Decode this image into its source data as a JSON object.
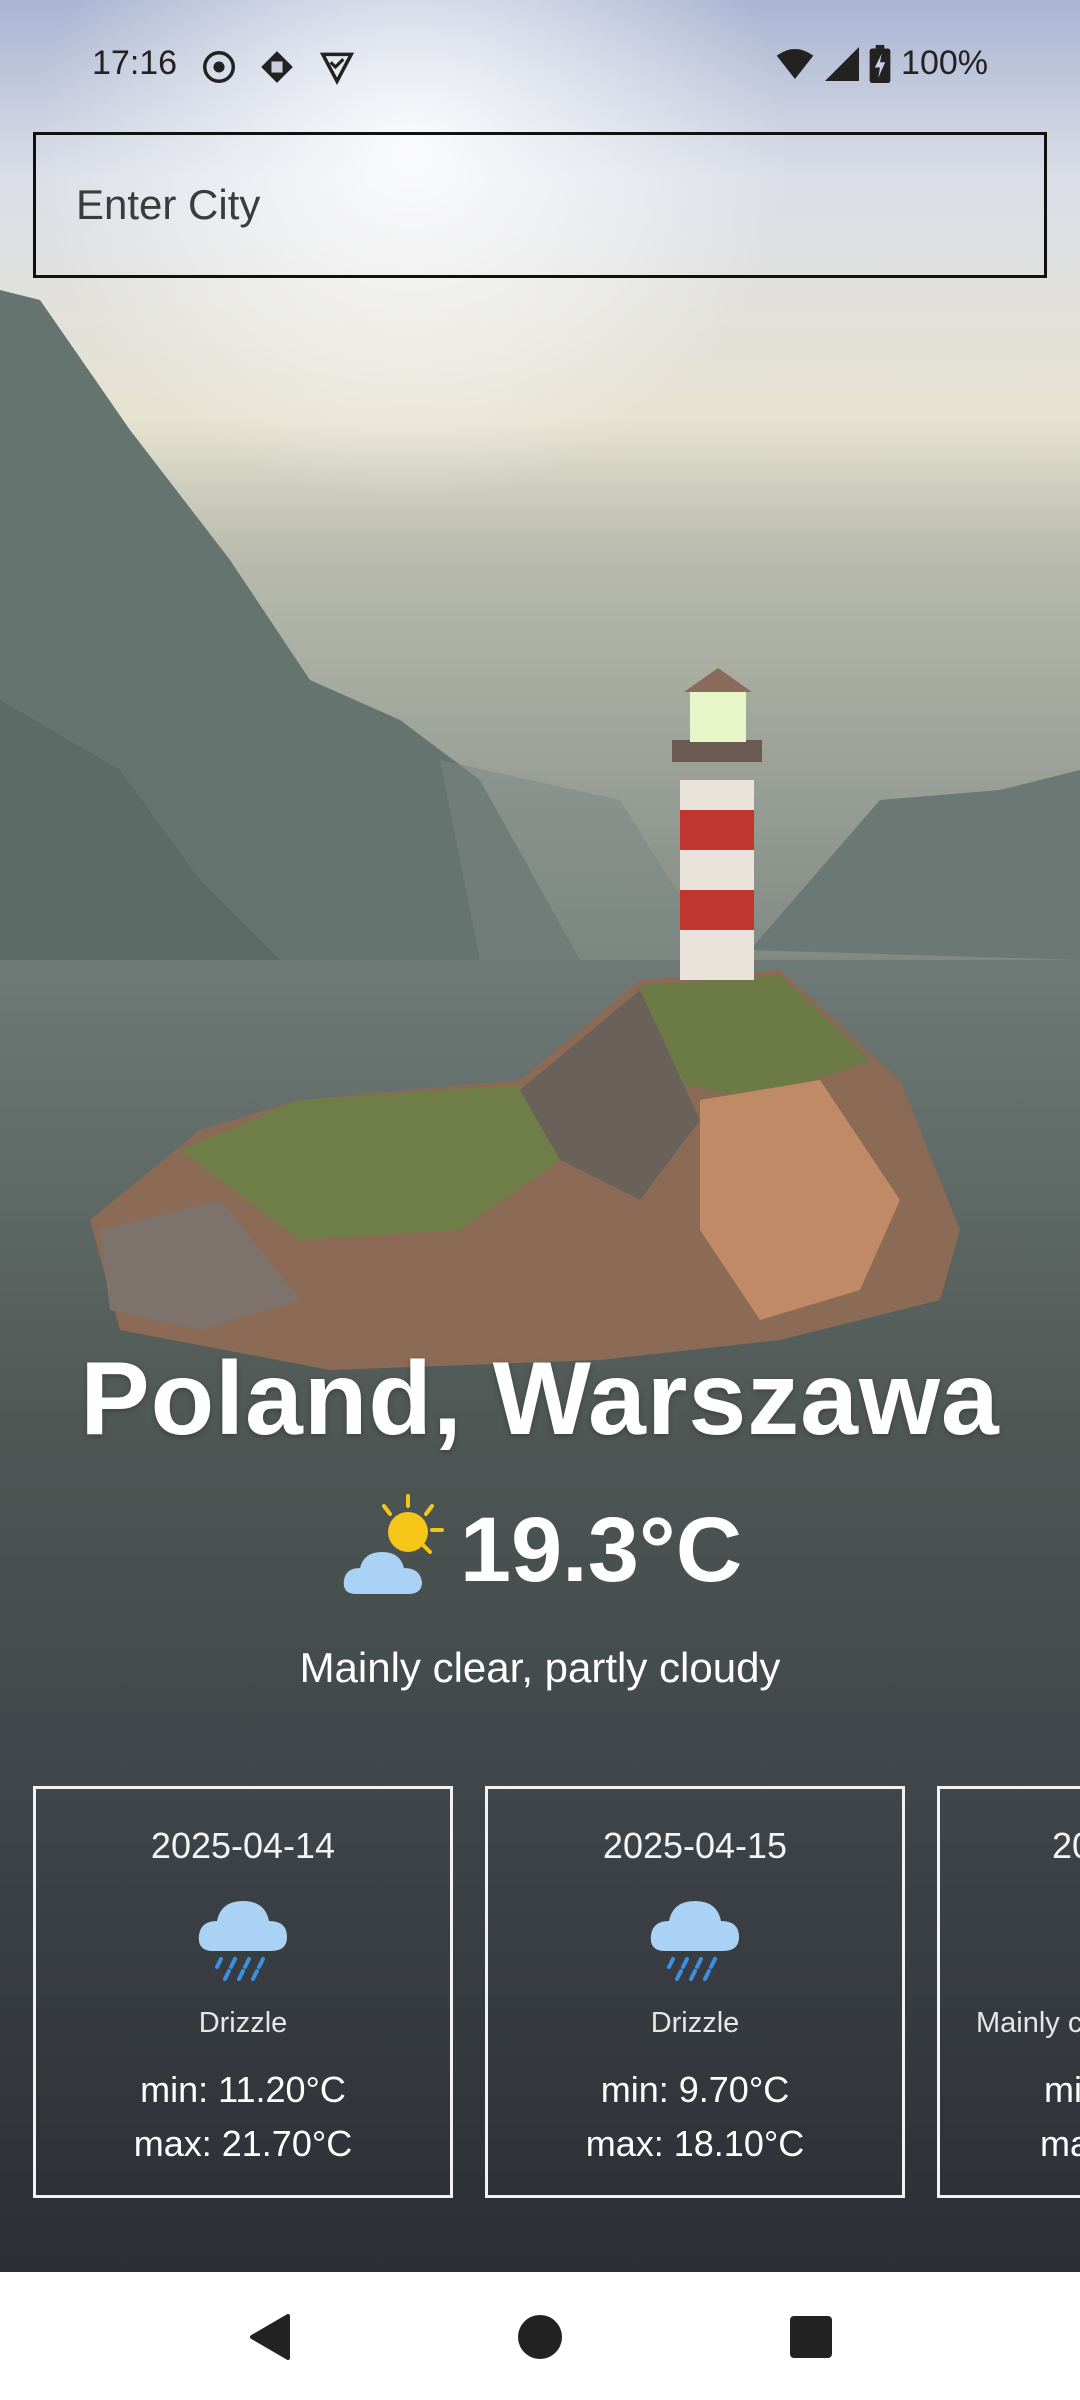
{
  "status_bar": {
    "time": "17:16",
    "battery": "100%",
    "left_icons": [
      "settings-gear-icon",
      "vpn-diamond-icon",
      "shield-check-icon"
    ],
    "right_icons": [
      "wifi-icon",
      "signal-icon",
      "battery-charging-icon"
    ]
  },
  "search": {
    "placeholder": "Enter City",
    "value": ""
  },
  "current": {
    "location": "Poland, Warszawa",
    "temperature": "19.3°C",
    "condition": "Mainly clear, partly cloudy",
    "icon": "partly-cloudy-sun-icon"
  },
  "forecast": [
    {
      "date": "2025-04-14",
      "icon": "rain-cloud-icon",
      "condition": "Drizzle",
      "min": "min: 11.20°C",
      "max": "max: 21.70°C"
    },
    {
      "date": "2025-04-15",
      "icon": "rain-cloud-icon",
      "condition": "Drizzle",
      "min": "min: 9.70°C",
      "max": "max: 18.10°C"
    },
    {
      "date": "20",
      "icon": "",
      "condition": "Mainly c",
      "min": "mi",
      "max": "ma"
    }
  ],
  "nav": {
    "buttons": [
      "back-icon",
      "home-icon",
      "recents-icon"
    ]
  },
  "colors": {
    "text_primary": "#ffffff",
    "card_border": "#f2f2f2",
    "nav_background": "#ffffff",
    "sun": "#f5c518",
    "cloud": "#a9d2f5",
    "rain": "#3d8fe0"
  }
}
